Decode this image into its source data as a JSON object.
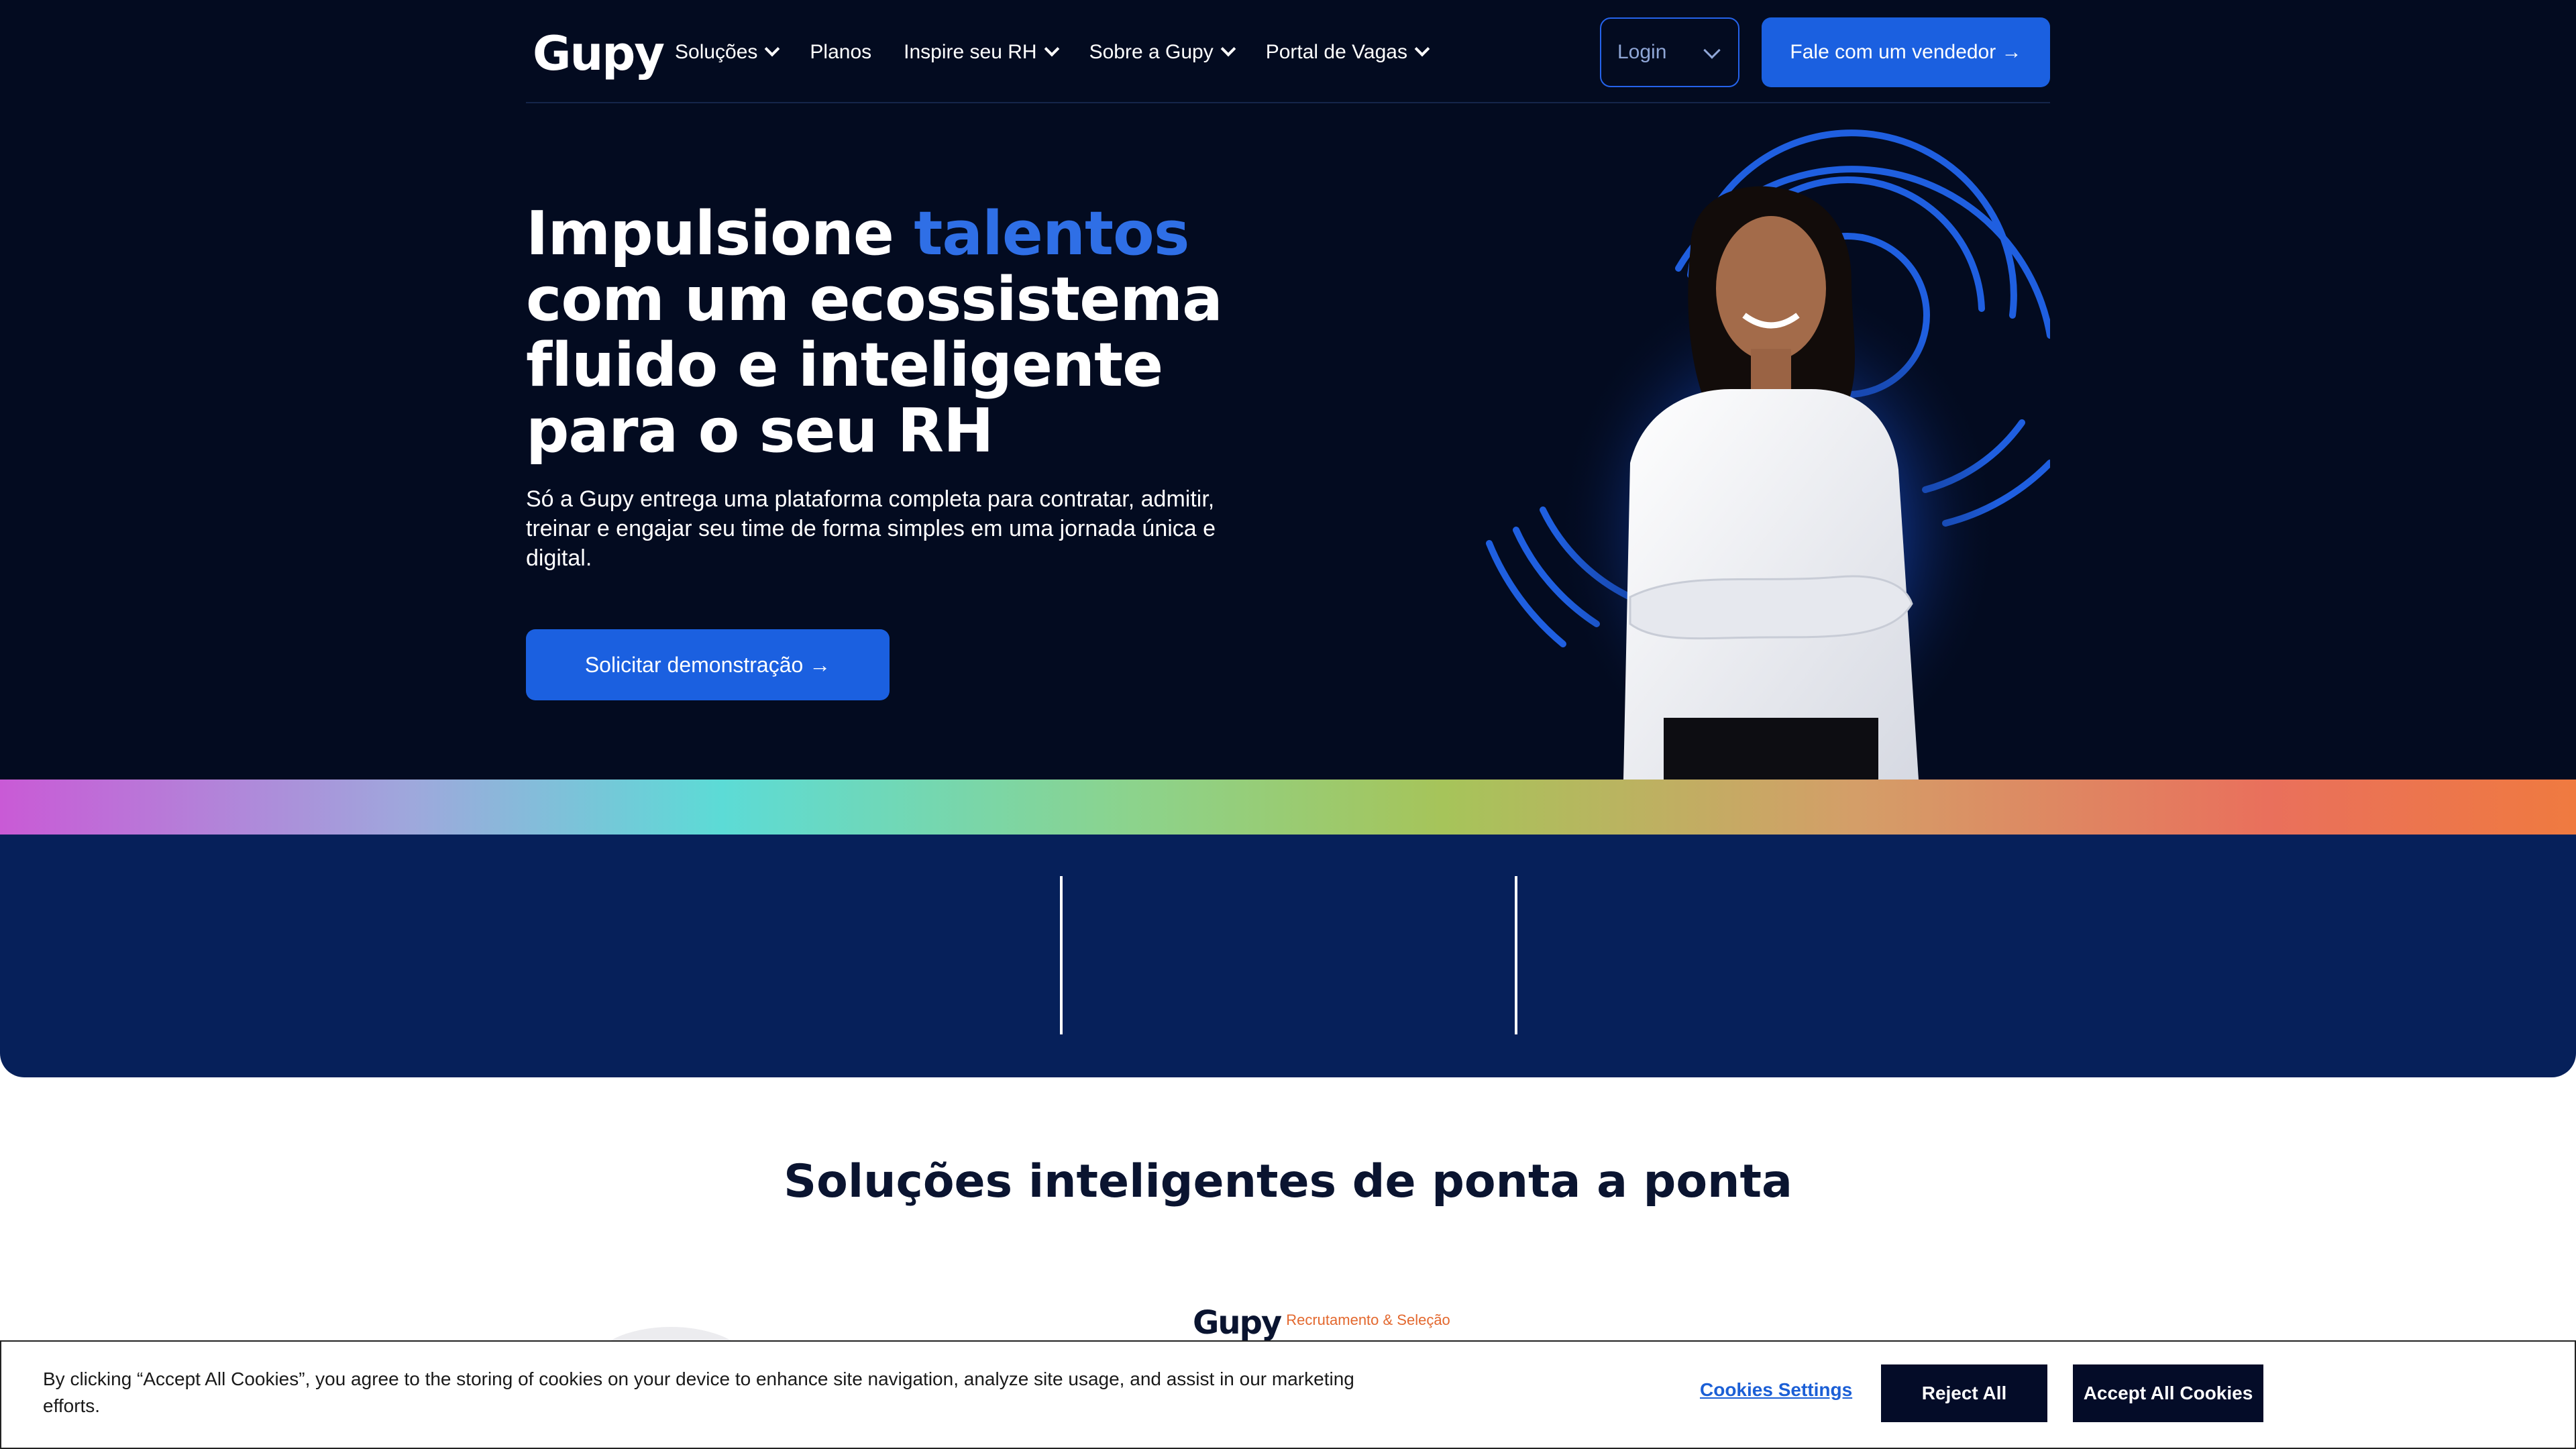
{
  "header": {
    "logo_text": "Gupy",
    "nav": [
      {
        "label": "Soluções"
      },
      {
        "label": "Planos"
      },
      {
        "label": "Inspire seu RH"
      },
      {
        "label": "Sobre a Gupy"
      },
      {
        "label": "Portal de Vagas"
      }
    ],
    "login_label": "Login",
    "cta_label": "Fale com um vendedor →"
  },
  "hero": {
    "headline_lead": "Impulsione ",
    "headline_accent": "talentos",
    "headline_rest": "com um ecossistema fluido e inteligente para o seu RH",
    "subtitle": "Só a Gupy entrega uma plataforma completa para contratar, admitir, treinar e engajar seu time de forma simples em uma jornada única e digital.",
    "cta_label": "Solicitar demonstração →"
  },
  "colors": {
    "hero_bg": "#030b20",
    "accent": "#2f6fe6",
    "primary_button": "#1b60e0",
    "stats_bg": "#06205a",
    "cookie_button": "#040c28",
    "brand_orange": "#e3682e"
  },
  "solutions": {
    "title": "Soluções inteligentes de ponta a ponta",
    "product_logo": "Gupy",
    "product_label": "Recrutamento & Seleção"
  },
  "cookie": {
    "text": "By clicking “Accept All Cookies”, you agree to the storing of cookies on your device to enhance site navigation, analyze site usage, and assist in our marketing efforts.",
    "settings_label": "Cookies Settings",
    "reject_label": "Reject All",
    "accept_label": "Accept All Cookies"
  }
}
